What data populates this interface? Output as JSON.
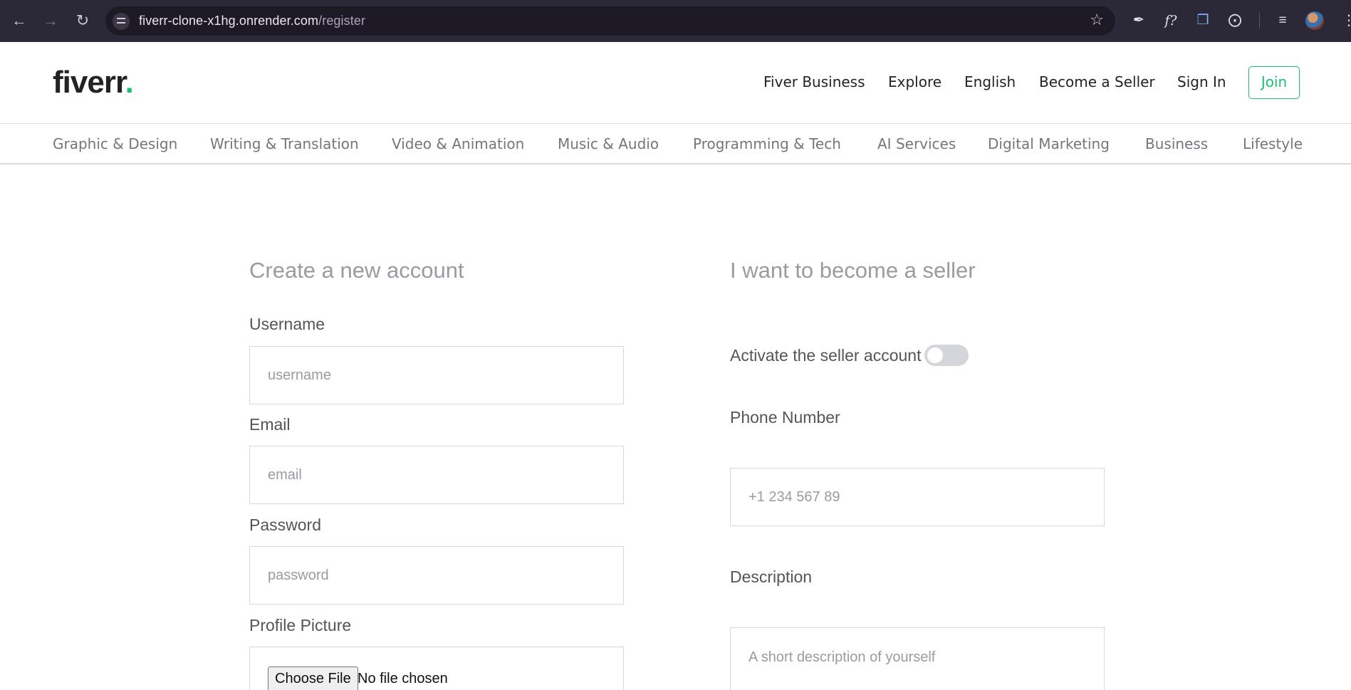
{
  "browser": {
    "url_host": "fiverr-clone-x1hg.onrender.com",
    "url_path": "/register",
    "icons": [
      "back-icon",
      "forward-icon",
      "reload-icon",
      "site-settings-icon",
      "bookmark-star-icon",
      "eyedropper-icon",
      "fx-extension-icon",
      "copy-extension-icon",
      "extensions-puzzle-icon",
      "reading-list-icon",
      "profile-avatar-icon",
      "menu-kebab-icon"
    ]
  },
  "brand": {
    "logo_text": "fiverr",
    "logo_dot": ".",
    "accent_color": "#1dbf73"
  },
  "top_nav": {
    "items": [
      "Fiver Business",
      "Explore",
      "English",
      "Become a Seller",
      "Sign In"
    ],
    "join_label": "Join"
  },
  "categories": [
    "Graphic & Design",
    "Writing & Translation",
    "Video & Animation",
    "Music & Audio",
    "Programming & Tech",
    "AI Services",
    "Digital Marketing",
    "Business",
    "Lifestyle"
  ],
  "form": {
    "left_title": "Create a new account",
    "username_label": "Username",
    "username_placeholder": "username",
    "email_label": "Email",
    "email_placeholder": "email",
    "password_label": "Password",
    "password_placeholder": "password",
    "picture_label": "Profile Picture",
    "file_button": "Choose File",
    "file_status": "No file chosen",
    "right_title": "I want to become a seller",
    "seller_toggle_label": "Activate the seller account",
    "seller_toggle_on": false,
    "phone_label": "Phone Number",
    "phone_placeholder": "+1 234 567 89",
    "description_label": "Description",
    "description_placeholder": "A short description of yourself"
  }
}
